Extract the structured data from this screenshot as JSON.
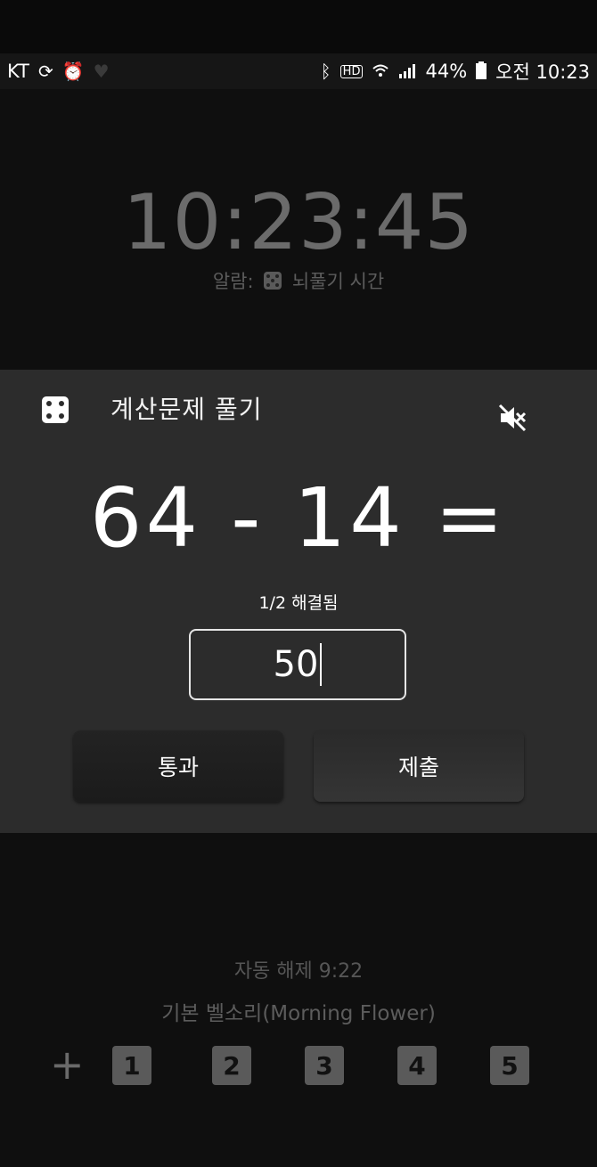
{
  "status_bar": {
    "carrier": "KT",
    "battery": "44%",
    "time": "오전 10:23"
  },
  "clock": "10:23:45",
  "alarm": {
    "prefix": "알람:",
    "name": "뇌풀기 시간"
  },
  "dialog": {
    "title": "계산문제 풀기",
    "question": "64 - 14 =",
    "progress": "1/2 해결됨",
    "answer_value": "50",
    "pass_label": "통과",
    "submit_label": "제출"
  },
  "auto_dismiss": "자동 해제 9:22",
  "ringtone": "기본 벨소리(Morning Flower)",
  "quick_add": {
    "plus": "+",
    "keys": [
      "1",
      "2",
      "3",
      "4",
      "5"
    ]
  },
  "colors": {
    "background": "#0f0f0f",
    "panel": "#2c2c2c",
    "text_primary": "#ffffff",
    "text_dim": "#5c5c5c"
  }
}
